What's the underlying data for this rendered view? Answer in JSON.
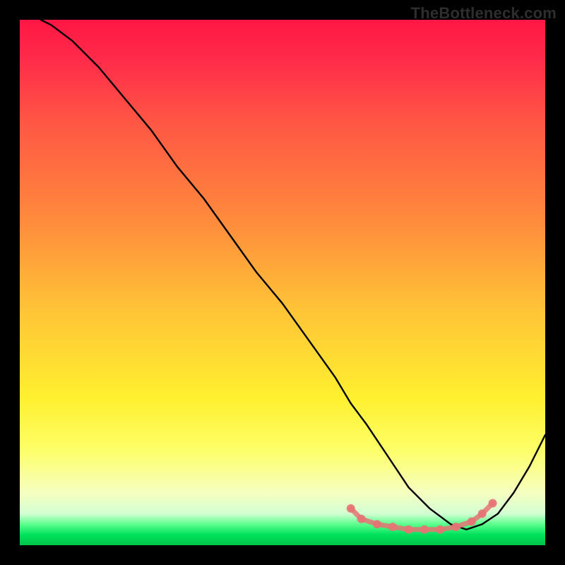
{
  "watermark": "TheBottleneck.com",
  "chart_data": {
    "type": "line",
    "title": "",
    "xlabel": "",
    "ylabel": "",
    "xlim": [
      0,
      100
    ],
    "ylim": [
      0,
      100
    ],
    "grid": false,
    "legend": false,
    "series": [
      {
        "name": "bottleneck-curve",
        "color": "#000000",
        "x": [
          4,
          6,
          10,
          15,
          20,
          25,
          30,
          35,
          40,
          45,
          50,
          55,
          60,
          63,
          66,
          70,
          74,
          78,
          82,
          85,
          88,
          91,
          94,
          97,
          100
        ],
        "y": [
          100,
          99,
          96,
          91,
          85,
          79,
          72,
          66,
          59,
          52,
          46,
          39,
          32,
          27,
          23,
          17,
          11,
          7,
          4,
          3,
          4,
          6,
          10,
          15,
          21
        ]
      }
    ],
    "highlight_band": {
      "name": "optimal-range-markers",
      "color": "#e57373",
      "x": [
        63,
        65,
        68,
        71,
        74,
        77,
        80,
        83,
        86,
        88,
        90
      ],
      "y": [
        7,
        5,
        4,
        3.5,
        3,
        3,
        3,
        3.5,
        4.5,
        6,
        8
      ]
    }
  }
}
